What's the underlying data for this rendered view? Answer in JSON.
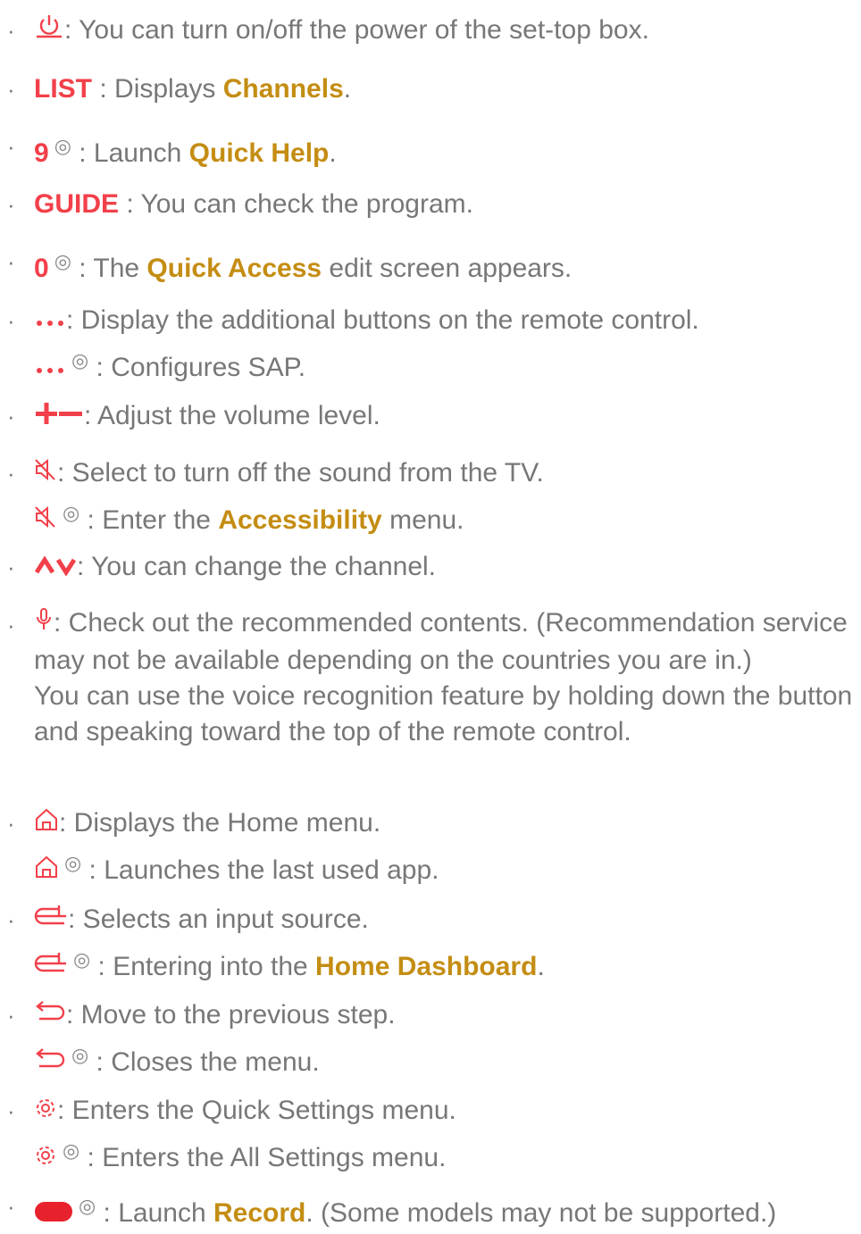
{
  "bullet": "·",
  "sep": ":",
  "hold_mark": "◎",
  "items": {
    "power": {
      "text": " You can turn on/off the power of the set-top box."
    },
    "list": {
      "key": "LIST",
      "text_before": " Displays ",
      "link": "Channels",
      "text_after": "."
    },
    "nine": {
      "key": "9",
      "text_before": " Launch ",
      "link": "Quick Help",
      "text_after": "."
    },
    "guide": {
      "key": "GUIDE",
      "text": " You can check the program."
    },
    "zero": {
      "key": "0",
      "text_before": " The ",
      "link": "Quick Access",
      "text_after": " edit screen appears."
    },
    "more": {
      "text": " Display the additional buttons on the remote control.",
      "hold_text": " Configures SAP."
    },
    "volume": {
      "text": " Adjust the volume level."
    },
    "mute": {
      "text": " Select to turn off the sound from the TV.",
      "hold_text_before": " Enter the ",
      "hold_link": "Accessibility",
      "hold_text_after": " menu."
    },
    "channel": {
      "text": " You can change the channel."
    },
    "mic": {
      "text": " Check out the recommended contents. (Recommendation service may not be available depending on the countries you are in.)",
      "text2": "You can use the voice recognition feature by holding down the button and speaking toward the top of the remote control."
    },
    "home": {
      "text": " Displays the Home menu.",
      "hold_text": " Launches the last used app."
    },
    "input": {
      "text": " Selects an input source.",
      "hold_text_before": " Entering into the ",
      "hold_link": "Home Dashboard",
      "hold_text_after": "."
    },
    "back": {
      "text": " Move to the previous step.",
      "hold_text": " Closes the menu."
    },
    "settings": {
      "text": " Enters the Quick Settings menu.",
      "hold_text": " Enters the All Settings menu."
    },
    "record": {
      "text_before": " Launch ",
      "link": "Record",
      "text_after": ". (Some models may not be supported.)"
    }
  },
  "colors": {
    "key_red": "#f2404a",
    "link_gold": "#c48d13",
    "body_text": "#777777"
  }
}
